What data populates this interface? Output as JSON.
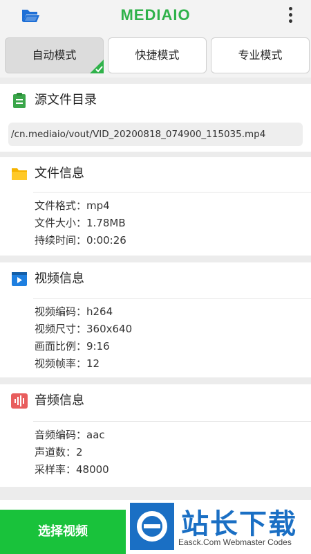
{
  "header": {
    "logo": "MEDIAIO",
    "icons": {
      "left": "open-folder-icon",
      "right": "more-vertical-icon"
    },
    "brand_color": "#2fb24a"
  },
  "modes": [
    {
      "label": "自动模式",
      "active": true
    },
    {
      "label": "快捷模式",
      "active": false
    },
    {
      "label": "专业模式",
      "active": false
    }
  ],
  "source": {
    "title": "源文件目录",
    "icon": "clipboard-icon",
    "path": "/cn.mediaio/vout/VID_20200818_074900_115035.mp4"
  },
  "file_info": {
    "title": "文件信息",
    "icon": "folder-icon",
    "rows": [
      "文件格式：mp4",
      "文件大小：1.78MB",
      "持续时间：0:00:26"
    ]
  },
  "video_info": {
    "title": "视频信息",
    "icon": "video-icon",
    "rows": [
      "视频编码：h264",
      "视频尺寸：360x640",
      "画面比例：9:16",
      "视频帧率：12"
    ]
  },
  "audio_info": {
    "title": "音频信息",
    "icon": "audio-wave-icon",
    "rows": [
      "音频编码：aac",
      "声道数：2",
      "采样率：48000"
    ]
  },
  "bottom": {
    "select_label": "选择视频",
    "watermark_big": "站长下载",
    "watermark_small": "Easck.Com Webmaster Codes"
  }
}
